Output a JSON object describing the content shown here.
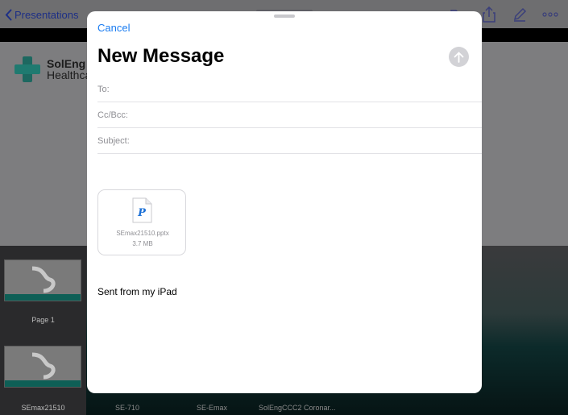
{
  "background": {
    "back_label": "Presentations",
    "toolbar_icons": [
      "folder-icon",
      "share-icon",
      "pencil-icon",
      "more-icon"
    ],
    "logo": {
      "line1": "SolEng",
      "line2": "Healthca"
    },
    "sidebar": {
      "thumbnails": [
        {
          "label": "Page 1"
        },
        {
          "label": "SEmax21510"
        }
      ]
    },
    "bottom_items": [
      "SE-710",
      "SE-Emax",
      "SolEngCCC2 Coronar..."
    ]
  },
  "compose": {
    "cancel_label": "Cancel",
    "title": "New Message",
    "fields": {
      "to": {
        "label": "To:",
        "value": ""
      },
      "ccbcc": {
        "label": "Cc/Bcc:",
        "value": ""
      },
      "subject": {
        "label": "Subject:",
        "value": ""
      }
    },
    "attachment": {
      "name": "SEmax21510.pptx",
      "size": "3.7 MB",
      "icon_letter": "P"
    },
    "signature": "Sent from my iPad"
  },
  "colors": {
    "accent": "#1a7cf1",
    "send_disabled": "#d2d2d6",
    "back_link": "#1d2f86"
  }
}
